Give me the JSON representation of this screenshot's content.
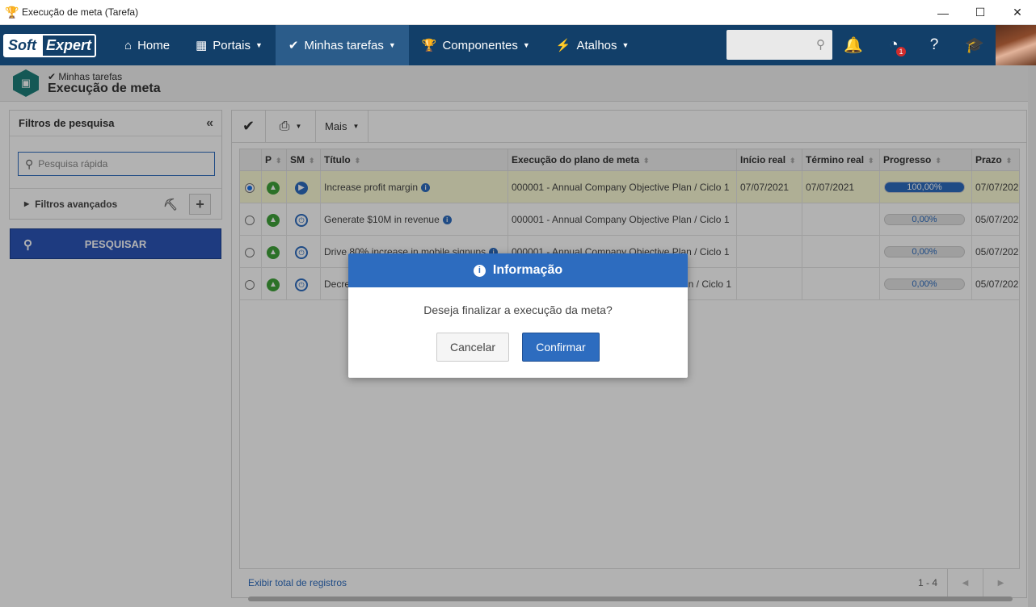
{
  "window": {
    "title": "Execução de meta (Tarefa)",
    "title_icon": "trophy-icon"
  },
  "nav": {
    "logo_part1": "Soft",
    "logo_part2": "Expert",
    "items": [
      {
        "label": "Home",
        "icon": "home-icon"
      },
      {
        "label": "Portais",
        "icon": "portals-icon"
      },
      {
        "label": "Minhas tarefas",
        "icon": "check-icon"
      },
      {
        "label": "Componentes",
        "icon": "trophy-icon"
      },
      {
        "label": "Atalhos",
        "icon": "bolt-icon"
      }
    ],
    "notification_badge": "1"
  },
  "page": {
    "breadcrumb": "Minhas tarefas",
    "title": "Execução de meta"
  },
  "filters": {
    "header": "Filtros de pesquisa",
    "quick_placeholder": "Pesquisa rápida",
    "advanced_label": "Filtros avançados",
    "search_button": "PESQUISAR"
  },
  "toolbar": {
    "more_label": "Mais"
  },
  "grid": {
    "columns": [
      "P",
      "SM",
      "Título",
      "Execução do plano de meta",
      "Início real",
      "Término real",
      "Progresso",
      "Prazo"
    ],
    "rows": [
      {
        "selected": true,
        "sm": "play",
        "title": "Increase profit margin",
        "plan": "000001 - Annual Company Objective Plan / Ciclo 1",
        "start": "07/07/2021",
        "end": "07/07/2021",
        "progress_label": "100,00%",
        "progress": 1.0,
        "deadline": "07/07/202"
      },
      {
        "selected": false,
        "sm": "power",
        "title": "Generate $10M in revenue",
        "plan": "000001 - Annual Company Objective Plan / Ciclo 1",
        "start": "",
        "end": "",
        "progress_label": "0,00%",
        "progress": 0,
        "deadline": "05/07/202"
      },
      {
        "selected": false,
        "sm": "power",
        "title": "Drive 80% increase in mobile signups",
        "plan": "000001 - Annual Company Objective Plan / Ciclo 1",
        "start": "",
        "end": "",
        "progress_label": "0,00%",
        "progress": 0,
        "deadline": "05/07/202"
      },
      {
        "selected": false,
        "sm": "power",
        "title": "Decre",
        "plan": "n / Ciclo 1",
        "start": "",
        "end": "",
        "progress_label": "0,00%",
        "progress": 0,
        "deadline": "05/07/202"
      }
    ],
    "footer_link": "Exibir total de registros",
    "count": "1 - 4"
  },
  "dialog": {
    "title": "Informação",
    "message": "Deseja finalizar a execução da meta?",
    "cancel": "Cancelar",
    "confirm": "Confirmar"
  }
}
